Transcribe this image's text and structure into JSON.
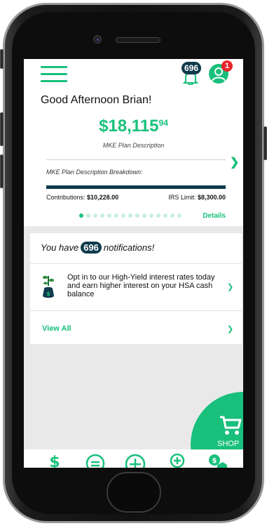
{
  "header": {
    "bell_count": "696",
    "avatar_badge": "1"
  },
  "greeting": "Good Afternoon Brian!",
  "balance": {
    "dollars": "$18,115",
    "cents": "94"
  },
  "plan": {
    "description": "MKE Plan Description",
    "breakdown_title": "MKE Plan Description Breakdown:",
    "progress_fraction": 1.0,
    "contributions_label": "Contributions:",
    "contributions_value": "$10,228.00",
    "irs_label": "IRS Limit:",
    "irs_value": "$8,300.00",
    "details_label": "Details",
    "pager_count": 15,
    "pager_active": 0
  },
  "notifications": {
    "prefix": "You have",
    "count": "696",
    "suffix": "notifications!",
    "item_text": "Opt in to our High-Yield interest rates today and earn higher interest on your HSA cash balance",
    "view_all": "View All"
  },
  "shop": {
    "label": "SHOP"
  },
  "icons": {
    "menu": "hamburger-icon",
    "bell": "bell-icon",
    "avatar": "user-avatar-icon",
    "promo": "money-plant-icon",
    "shop": "shopping-cart-icon",
    "nav": [
      "dollar-icon",
      "minus-circle-icon",
      "plus-circle-icon",
      "plus-circle-small-icon",
      "money-hand-icon"
    ]
  },
  "colors": {
    "brand_green": "#19c07b",
    "navy": "#0f3b4c",
    "badge_red": "#e8262d"
  }
}
